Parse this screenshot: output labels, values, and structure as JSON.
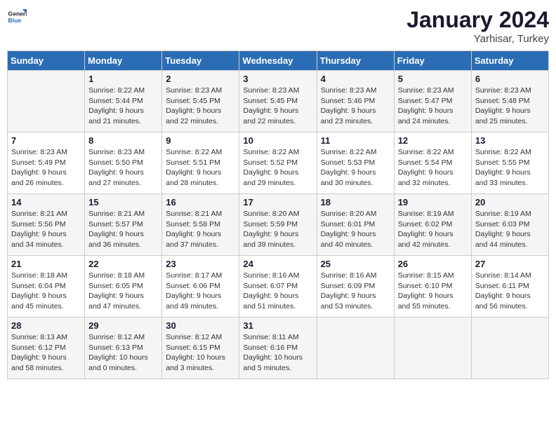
{
  "header": {
    "logo_line1": "General",
    "logo_line2": "Blue",
    "month": "January 2024",
    "location": "Yarhisar, Turkey"
  },
  "weekdays": [
    "Sunday",
    "Monday",
    "Tuesday",
    "Wednesday",
    "Thursday",
    "Friday",
    "Saturday"
  ],
  "weeks": [
    [
      {
        "num": "",
        "info": ""
      },
      {
        "num": "1",
        "info": "Sunrise: 8:22 AM\nSunset: 5:44 PM\nDaylight: 9 hours\nand 21 minutes."
      },
      {
        "num": "2",
        "info": "Sunrise: 8:23 AM\nSunset: 5:45 PM\nDaylight: 9 hours\nand 22 minutes."
      },
      {
        "num": "3",
        "info": "Sunrise: 8:23 AM\nSunset: 5:45 PM\nDaylight: 9 hours\nand 22 minutes."
      },
      {
        "num": "4",
        "info": "Sunrise: 8:23 AM\nSunset: 5:46 PM\nDaylight: 9 hours\nand 23 minutes."
      },
      {
        "num": "5",
        "info": "Sunrise: 8:23 AM\nSunset: 5:47 PM\nDaylight: 9 hours\nand 24 minutes."
      },
      {
        "num": "6",
        "info": "Sunrise: 8:23 AM\nSunset: 5:48 PM\nDaylight: 9 hours\nand 25 minutes."
      }
    ],
    [
      {
        "num": "7",
        "info": "Sunrise: 8:23 AM\nSunset: 5:49 PM\nDaylight: 9 hours\nand 26 minutes."
      },
      {
        "num": "8",
        "info": "Sunrise: 8:23 AM\nSunset: 5:50 PM\nDaylight: 9 hours\nand 27 minutes."
      },
      {
        "num": "9",
        "info": "Sunrise: 8:22 AM\nSunset: 5:51 PM\nDaylight: 9 hours\nand 28 minutes."
      },
      {
        "num": "10",
        "info": "Sunrise: 8:22 AM\nSunset: 5:52 PM\nDaylight: 9 hours\nand 29 minutes."
      },
      {
        "num": "11",
        "info": "Sunrise: 8:22 AM\nSunset: 5:53 PM\nDaylight: 9 hours\nand 30 minutes."
      },
      {
        "num": "12",
        "info": "Sunrise: 8:22 AM\nSunset: 5:54 PM\nDaylight: 9 hours\nand 32 minutes."
      },
      {
        "num": "13",
        "info": "Sunrise: 8:22 AM\nSunset: 5:55 PM\nDaylight: 9 hours\nand 33 minutes."
      }
    ],
    [
      {
        "num": "14",
        "info": "Sunrise: 8:21 AM\nSunset: 5:56 PM\nDaylight: 9 hours\nand 34 minutes."
      },
      {
        "num": "15",
        "info": "Sunrise: 8:21 AM\nSunset: 5:57 PM\nDaylight: 9 hours\nand 36 minutes."
      },
      {
        "num": "16",
        "info": "Sunrise: 8:21 AM\nSunset: 5:58 PM\nDaylight: 9 hours\nand 37 minutes."
      },
      {
        "num": "17",
        "info": "Sunrise: 8:20 AM\nSunset: 5:59 PM\nDaylight: 9 hours\nand 39 minutes."
      },
      {
        "num": "18",
        "info": "Sunrise: 8:20 AM\nSunset: 6:01 PM\nDaylight: 9 hours\nand 40 minutes."
      },
      {
        "num": "19",
        "info": "Sunrise: 8:19 AM\nSunset: 6:02 PM\nDaylight: 9 hours\nand 42 minutes."
      },
      {
        "num": "20",
        "info": "Sunrise: 8:19 AM\nSunset: 6:03 PM\nDaylight: 9 hours\nand 44 minutes."
      }
    ],
    [
      {
        "num": "21",
        "info": "Sunrise: 8:18 AM\nSunset: 6:04 PM\nDaylight: 9 hours\nand 45 minutes."
      },
      {
        "num": "22",
        "info": "Sunrise: 8:18 AM\nSunset: 6:05 PM\nDaylight: 9 hours\nand 47 minutes."
      },
      {
        "num": "23",
        "info": "Sunrise: 8:17 AM\nSunset: 6:06 PM\nDaylight: 9 hours\nand 49 minutes."
      },
      {
        "num": "24",
        "info": "Sunrise: 8:16 AM\nSunset: 6:07 PM\nDaylight: 9 hours\nand 51 minutes."
      },
      {
        "num": "25",
        "info": "Sunrise: 8:16 AM\nSunset: 6:09 PM\nDaylight: 9 hours\nand 53 minutes."
      },
      {
        "num": "26",
        "info": "Sunrise: 8:15 AM\nSunset: 6:10 PM\nDaylight: 9 hours\nand 55 minutes."
      },
      {
        "num": "27",
        "info": "Sunrise: 8:14 AM\nSunset: 6:11 PM\nDaylight: 9 hours\nand 56 minutes."
      }
    ],
    [
      {
        "num": "28",
        "info": "Sunrise: 8:13 AM\nSunset: 6:12 PM\nDaylight: 9 hours\nand 58 minutes."
      },
      {
        "num": "29",
        "info": "Sunrise: 8:12 AM\nSunset: 6:13 PM\nDaylight: 10 hours\nand 0 minutes."
      },
      {
        "num": "30",
        "info": "Sunrise: 8:12 AM\nSunset: 6:15 PM\nDaylight: 10 hours\nand 3 minutes."
      },
      {
        "num": "31",
        "info": "Sunrise: 8:11 AM\nSunset: 6:16 PM\nDaylight: 10 hours\nand 5 minutes."
      },
      {
        "num": "",
        "info": ""
      },
      {
        "num": "",
        "info": ""
      },
      {
        "num": "",
        "info": ""
      }
    ]
  ]
}
